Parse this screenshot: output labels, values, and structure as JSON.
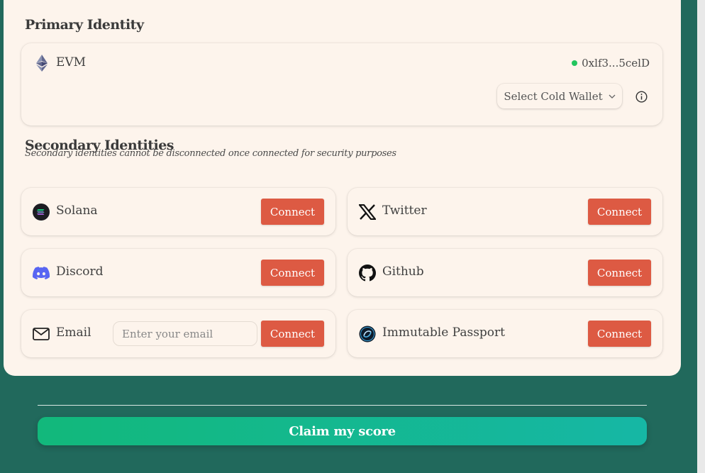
{
  "primary": {
    "title": "Primary Identity",
    "chain_label": "EVM",
    "address": "0xlf3...5celD",
    "select_wallet_label": "Select Cold Wallet"
  },
  "secondary": {
    "title": "Secondary Identities",
    "subtitle": "Secondary identities cannot be disconnected once connected for security purposes",
    "items": [
      {
        "label": "Solana",
        "icon": "solana-icon",
        "button": "Connect"
      },
      {
        "label": "Twitter",
        "icon": "x-twitter-icon",
        "button": "Connect"
      },
      {
        "label": "Discord",
        "icon": "discord-icon",
        "button": "Connect"
      },
      {
        "label": "Github",
        "icon": "github-icon",
        "button": "Connect"
      },
      {
        "label": "Email",
        "icon": "mail-icon",
        "button": "Connect",
        "placeholder": "Enter your email"
      },
      {
        "label": "Immutable Passport",
        "icon": "immutable-passport-icon",
        "button": "Connect"
      }
    ]
  },
  "claim": {
    "label": "Claim my score"
  },
  "colors": {
    "background": "#21695c",
    "card": "#fdf4ec",
    "connect": "#dd5a43",
    "status_dot": "#22c55e",
    "claim_gradient_start": "#12b87b",
    "claim_gradient_end": "#16b7a5"
  }
}
